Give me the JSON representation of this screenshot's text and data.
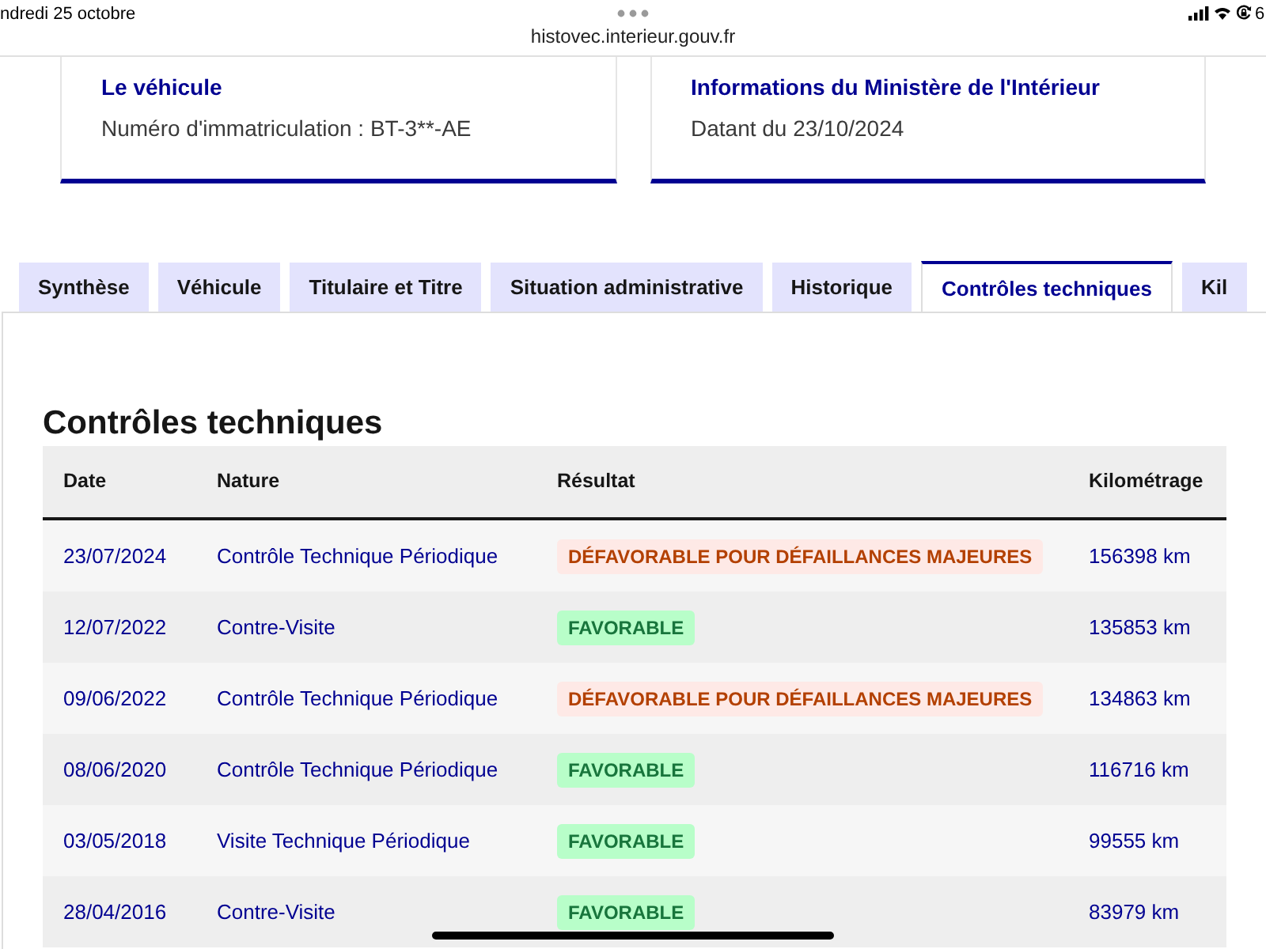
{
  "status_bar": {
    "date": "ndredi 25 octobre",
    "battery": "6"
  },
  "address_bar": {
    "url": "histovec.interieur.gouv.fr"
  },
  "cards": [
    {
      "title": "Le véhicule",
      "text": "Numéro d'immatriculation : BT-3**-AE"
    },
    {
      "title": "Informations du Ministère de l'Intérieur",
      "text": "Datant du 23/10/2024"
    }
  ],
  "tabs": [
    {
      "label": "Synthèse",
      "selected": false
    },
    {
      "label": "Véhicule",
      "selected": false
    },
    {
      "label": "Titulaire et Titre",
      "selected": false
    },
    {
      "label": "Situation administrative",
      "selected": false
    },
    {
      "label": "Historique",
      "selected": false
    },
    {
      "label": "Contrôles techniques",
      "selected": true
    },
    {
      "label": "Kil",
      "selected": false
    }
  ],
  "section": {
    "title": "Contrôles techniques"
  },
  "table": {
    "columns": [
      "Date",
      "Nature",
      "Résultat",
      "Kilométrage"
    ],
    "rows": [
      {
        "date": "23/07/2024",
        "nature": "Contrôle Technique Périodique",
        "result": {
          "kind": "unfavorable",
          "label": "DÉFAVORABLE POUR DÉFAILLANCES MAJEURES"
        },
        "mileage": "156398 km"
      },
      {
        "date": "12/07/2022",
        "nature": "Contre-Visite",
        "result": {
          "kind": "favorable",
          "label": "FAVORABLE"
        },
        "mileage": "135853 km"
      },
      {
        "date": "09/06/2022",
        "nature": "Contrôle Technique Périodique",
        "result": {
          "kind": "unfavorable",
          "label": "DÉFAVORABLE POUR DÉFAILLANCES MAJEURES"
        },
        "mileage": "134863 km"
      },
      {
        "date": "08/06/2020",
        "nature": "Contrôle Technique Périodique",
        "result": {
          "kind": "favorable",
          "label": "FAVORABLE"
        },
        "mileage": "116716 km"
      },
      {
        "date": "03/05/2018",
        "nature": "Visite Technique Périodique",
        "result": {
          "kind": "favorable",
          "label": "FAVORABLE"
        },
        "mileage": "99555 km"
      },
      {
        "date": "28/04/2016",
        "nature": "Contre-Visite",
        "result": {
          "kind": "favorable",
          "label": "FAVORABLE"
        },
        "mileage": "83979 km"
      }
    ]
  }
}
